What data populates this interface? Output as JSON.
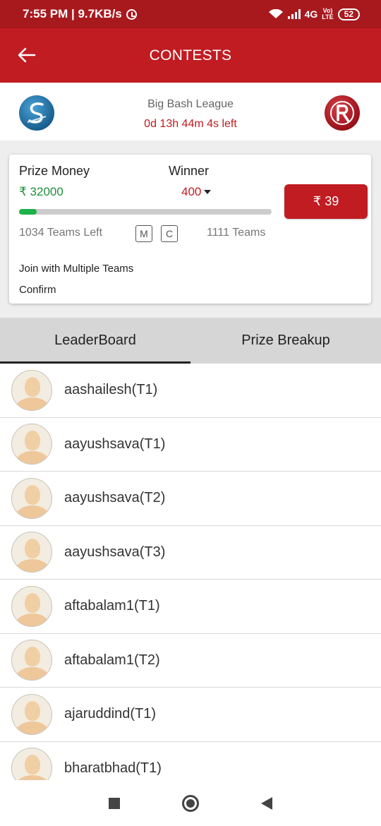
{
  "status_bar": {
    "time_speed": "7:55 PM | 9.7KB/s",
    "network": "4G",
    "volte_top": "Vo)",
    "volte_bottom": "LTE",
    "battery": "52"
  },
  "app_bar": {
    "title": "CONTESTS"
  },
  "match": {
    "league": "Big Bash League",
    "time_left": "0d 13h 44m 4s left"
  },
  "contest": {
    "prize_label": "Prize Money",
    "prize_value": "₹ 32000",
    "winner_label": "Winner",
    "winner_value": "400",
    "entry_fee": "₹ 39",
    "progress_fraction": 0.069,
    "teams_left": "1034 Teams Left",
    "badge_m": "M",
    "badge_c": "C",
    "teams_total": "1111 Teams",
    "multi_join": "Join with Multiple Teams",
    "confirm": "Confirm"
  },
  "tabs": [
    {
      "label": "LeaderBoard",
      "active": true
    },
    {
      "label": "Prize Breakup",
      "active": false
    }
  ],
  "leaderboard": [
    {
      "name": "aashailesh(T1)"
    },
    {
      "name": "aayushsava(T1)"
    },
    {
      "name": "aayushsava(T2)"
    },
    {
      "name": "aayushsava(T3)"
    },
    {
      "name": "aftabalam1(T1)"
    },
    {
      "name": "aftabalam1(T2)"
    },
    {
      "name": "ajaruddind(T1)"
    },
    {
      "name": "bharatbhad(T1)"
    }
  ],
  "colors": {
    "primary": "#c01c21",
    "status_bar": "#a8191e",
    "prize_green": "#1d8f3a",
    "progress_green": "#1db24a"
  }
}
